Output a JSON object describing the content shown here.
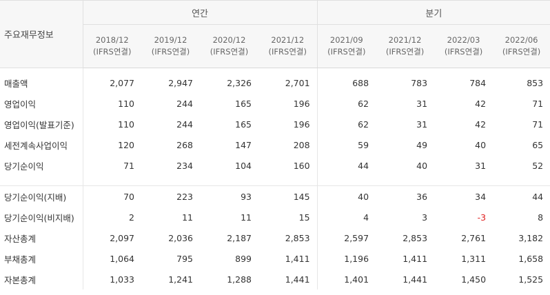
{
  "header": {
    "row_label": "주요재무정보",
    "group_annual": "연간",
    "group_quarter": "분기",
    "columns": [
      {
        "period": "2018/12",
        "basis": "(IFRS연결)"
      },
      {
        "period": "2019/12",
        "basis": "(IFRS연결)"
      },
      {
        "period": "2020/12",
        "basis": "(IFRS연결)"
      },
      {
        "period": "2021/12",
        "basis": "(IFRS연결)"
      },
      {
        "period": "2021/09",
        "basis": "(IFRS연결)"
      },
      {
        "period": "2021/12",
        "basis": "(IFRS연결)"
      },
      {
        "period": "2022/03",
        "basis": "(IFRS연결)"
      },
      {
        "period": "2022/06",
        "basis": "(IFRS연결)"
      }
    ]
  },
  "rows_group1": [
    {
      "label": "매출액",
      "values": [
        "2,077",
        "2,947",
        "2,326",
        "2,701",
        "688",
        "783",
        "784",
        "853"
      ]
    },
    {
      "label": "영업이익",
      "values": [
        "110",
        "244",
        "165",
        "196",
        "62",
        "31",
        "42",
        "71"
      ]
    },
    {
      "label": "영업이익(발표기준)",
      "values": [
        "110",
        "244",
        "165",
        "196",
        "62",
        "31",
        "42",
        "71"
      ]
    },
    {
      "label": "세전계속사업이익",
      "values": [
        "120",
        "268",
        "147",
        "208",
        "59",
        "49",
        "40",
        "65"
      ]
    },
    {
      "label": "당기순이익",
      "values": [
        "71",
        "234",
        "104",
        "160",
        "44",
        "40",
        "31",
        "52"
      ]
    }
  ],
  "rows_group2": [
    {
      "label": "당기순이익(지배)",
      "values": [
        "70",
        "223",
        "93",
        "145",
        "40",
        "36",
        "34",
        "44"
      ]
    },
    {
      "label": "당기순이익(비지배)",
      "values": [
        "2",
        "11",
        "11",
        "15",
        "4",
        "3",
        "-3",
        "8"
      ]
    },
    {
      "label": "자산총계",
      "values": [
        "2,097",
        "2,036",
        "2,187",
        "2,853",
        "2,597",
        "2,853",
        "2,761",
        "3,182"
      ]
    },
    {
      "label": "부채총계",
      "values": [
        "1,064",
        "795",
        "899",
        "1,411",
        "1,196",
        "1,411",
        "1,311",
        "1,658"
      ]
    },
    {
      "label": "자본총계",
      "values": [
        "1,033",
        "1,241",
        "1,288",
        "1,441",
        "1,401",
        "1,441",
        "1,450",
        "1,525"
      ]
    }
  ],
  "colors": {
    "negative": "#e02020",
    "header_bg": "#f7f7f7",
    "border": "#e0e0e0"
  }
}
